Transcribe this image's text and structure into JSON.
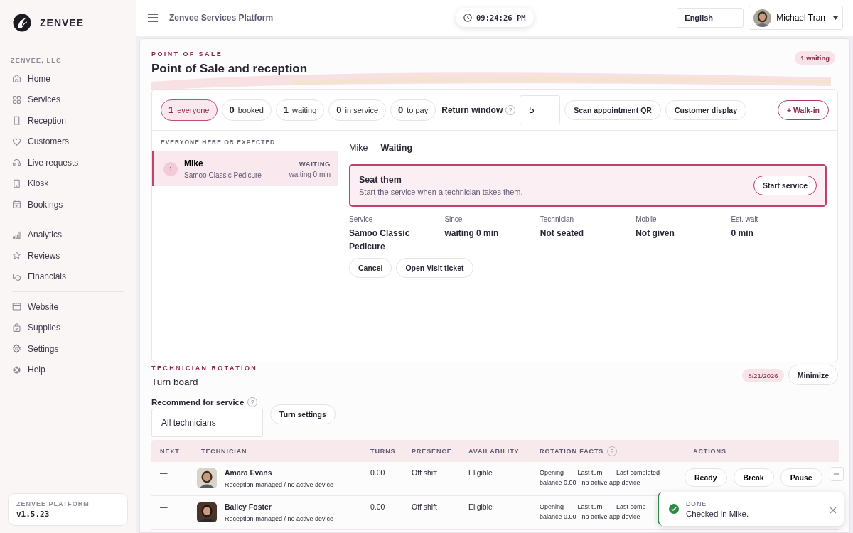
{
  "brand": {
    "name": "ZENVEE"
  },
  "sidebar": {
    "org": "ZENVEE, LLC",
    "groups": [
      [
        {
          "label": "Home"
        },
        {
          "label": "Services"
        },
        {
          "label": "Reception"
        },
        {
          "label": "Customers"
        },
        {
          "label": "Live requests"
        },
        {
          "label": "Kiosk"
        },
        {
          "label": "Bookings"
        }
      ],
      [
        {
          "label": "Analytics"
        },
        {
          "label": "Reviews"
        },
        {
          "label": "Financials"
        }
      ],
      [
        {
          "label": "Website"
        },
        {
          "label": "Supplies"
        },
        {
          "label": "Settings"
        },
        {
          "label": "Help"
        }
      ]
    ],
    "footer": {
      "label": "ZENVEE PLATFORM",
      "version": "v1.5.23"
    }
  },
  "topbar": {
    "title": "Zenvee Services Platform",
    "clock": "09:24:26 PM",
    "language": "English",
    "user": "Michael Tran"
  },
  "page": {
    "eyebrow": "POINT OF SALE",
    "title": "Point of Sale and reception",
    "badge": "1 waiting"
  },
  "filters": [
    {
      "count": "1",
      "label": "everyone",
      "selected": true
    },
    {
      "count": "0",
      "label": "booked",
      "selected": false
    },
    {
      "count": "1",
      "label": "waiting",
      "selected": false
    },
    {
      "count": "0",
      "label": "in service",
      "selected": false
    },
    {
      "count": "0",
      "label": "to pay",
      "selected": false
    }
  ],
  "return_window": {
    "label": "Return window",
    "help": "?",
    "value": "5"
  },
  "toolbar_buttons": [
    "Scan appointment QR",
    "Customer display"
  ],
  "walk_in": "+ Walk-in",
  "queue": {
    "heading": "EVERYONE HERE OR EXPECTED",
    "items": [
      {
        "number": "1",
        "name": "Mike",
        "service": "Samoo Classic Pedicure",
        "status": "WAITING",
        "wait": "waiting 0 min",
        "selected": true
      }
    ]
  },
  "detail": {
    "name": "Mike",
    "status": "Waiting",
    "callout": {
      "title": "Seat them",
      "text": "Start the service when a technician takes them.",
      "action": "Start service"
    },
    "facts": [
      {
        "label": "Service",
        "value": "Samoo Classic Pedicure"
      },
      {
        "label": "Since",
        "value": "waiting 0 min"
      },
      {
        "label": "Technician",
        "value": "Not seated"
      },
      {
        "label": "Mobile",
        "value": "Not given"
      },
      {
        "label": "Est. wait",
        "value": "0 min"
      }
    ],
    "buttons": [
      "Cancel",
      "Open Visit ticket"
    ]
  },
  "rotation": {
    "eyebrow": "TECHNICIAN ROTATION",
    "title": "Turn board",
    "date": "8/21/2026",
    "minimize": "Minimize",
    "recommend_label": "Recommend for service",
    "help": "?",
    "select": "All technicians",
    "settings_button": "Turn settings",
    "columns": [
      "NEXT",
      "TECHNICIAN",
      "TURNS",
      "PRESENCE",
      "AVAILABILITY",
      "ROTATION FACTS",
      "ACTIONS"
    ],
    "facts_help": "?",
    "rows": [
      {
        "next": "—",
        "name": "Amara Evans",
        "note": "Reception-managed / no active device",
        "turns": "0.00",
        "presence": "Off shift",
        "availability": "Eligible",
        "facts": [
          "Opening — · Last turn — · Last completed —",
          "balance 0.00 · no active app device"
        ],
        "actions": [
          "Ready",
          "Break",
          "Pause"
        ]
      },
      {
        "next": "—",
        "name": "Bailey Foster",
        "note": "Reception-managed / no active device",
        "turns": "0.00",
        "presence": "Off shift",
        "availability": "Eligible",
        "facts": [
          "Opening — · Last turn — · Last comp",
          "balance 0.00 · no active app device"
        ],
        "actions": []
      }
    ]
  },
  "toast": {
    "title": "DONE",
    "message": "Checked in Mike."
  }
}
